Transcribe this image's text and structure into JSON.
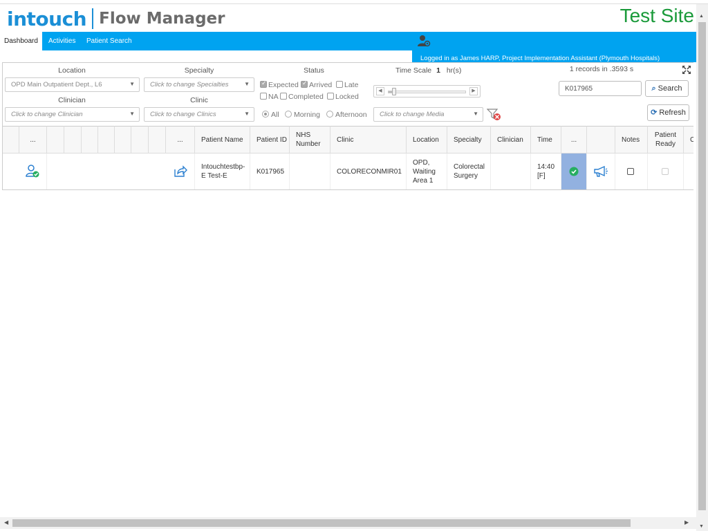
{
  "header": {
    "logo_primary": "intouch",
    "logo_secondary": "Flow Manager",
    "site_label": "Test Site",
    "logged_in": "Logged in as James HARP, Project Implementation Assistant (Plymouth Hospitals)"
  },
  "nav": {
    "tabs": [
      {
        "label": "Dashboard"
      },
      {
        "label": "Activities"
      },
      {
        "label": "Patient Search"
      }
    ]
  },
  "filters": {
    "location_label": "Location",
    "location_value": "OPD Main Outpatient Dept., L6",
    "specialty_label": "Specialty",
    "specialty_placeholder": "Click to change Specialties",
    "clinician_label": "Clinician",
    "clinician_placeholder": "Click to change Clinician",
    "clinic_label": "Clinic",
    "clinic_placeholder": "Click to change Clinics",
    "status_label": "Status",
    "status": {
      "expected": "Expected",
      "arrived": "Arrived",
      "late": "Late",
      "na": "NA",
      "completed": "Completed",
      "locked": "Locked"
    },
    "period": {
      "all": "All",
      "morning": "Morning",
      "afternoon": "Afternoon"
    },
    "timescale_label": "Time Scale",
    "timescale_value": "1",
    "timescale_unit": "hr(s)",
    "media_placeholder": "Click to change Media",
    "records_info": "1 records in .3593 s",
    "search_value": "K017965",
    "search_button": "Search",
    "refresh_button": "Refresh"
  },
  "table": {
    "headers": {
      "col_dots1": "...",
      "col_dots2": "...",
      "patient_name": "Patient Name",
      "patient_id": "Patient ID",
      "nhs_number": "NHS Number",
      "clinic": "Clinic",
      "location": "Location",
      "specialty": "Specialty",
      "clinician": "Clinician",
      "time": "Time",
      "col_dots3": "...",
      "notes": "Notes",
      "patient_ready": "Patient Ready",
      "overflow": "C"
    },
    "rows": [
      {
        "patient_name": "Intouchtestbp-E Test-E",
        "patient_id": "K017965",
        "nhs_number": "",
        "clinic": "COLORECONMIR01",
        "location": "OPD, Waiting Area 1",
        "specialty": "Colorectal Surgery",
        "clinician": "",
        "time": "14:40 [F]"
      }
    ]
  },
  "colors": {
    "brand_blue": "#00a3f0",
    "logo_blue": "#1b8fd6",
    "test_site_green": "#1a9a3a",
    "highlight_cell": "#92b1e0",
    "status_green": "#27ae60"
  },
  "icons": {
    "user_settings": "user-gear-icon",
    "filter_clear": "filter-clear-icon",
    "expand": "expand-icon",
    "patient_arrived": "user-check-icon",
    "share": "share-icon",
    "check": "check-circle-icon",
    "megaphone": "megaphone-icon"
  }
}
